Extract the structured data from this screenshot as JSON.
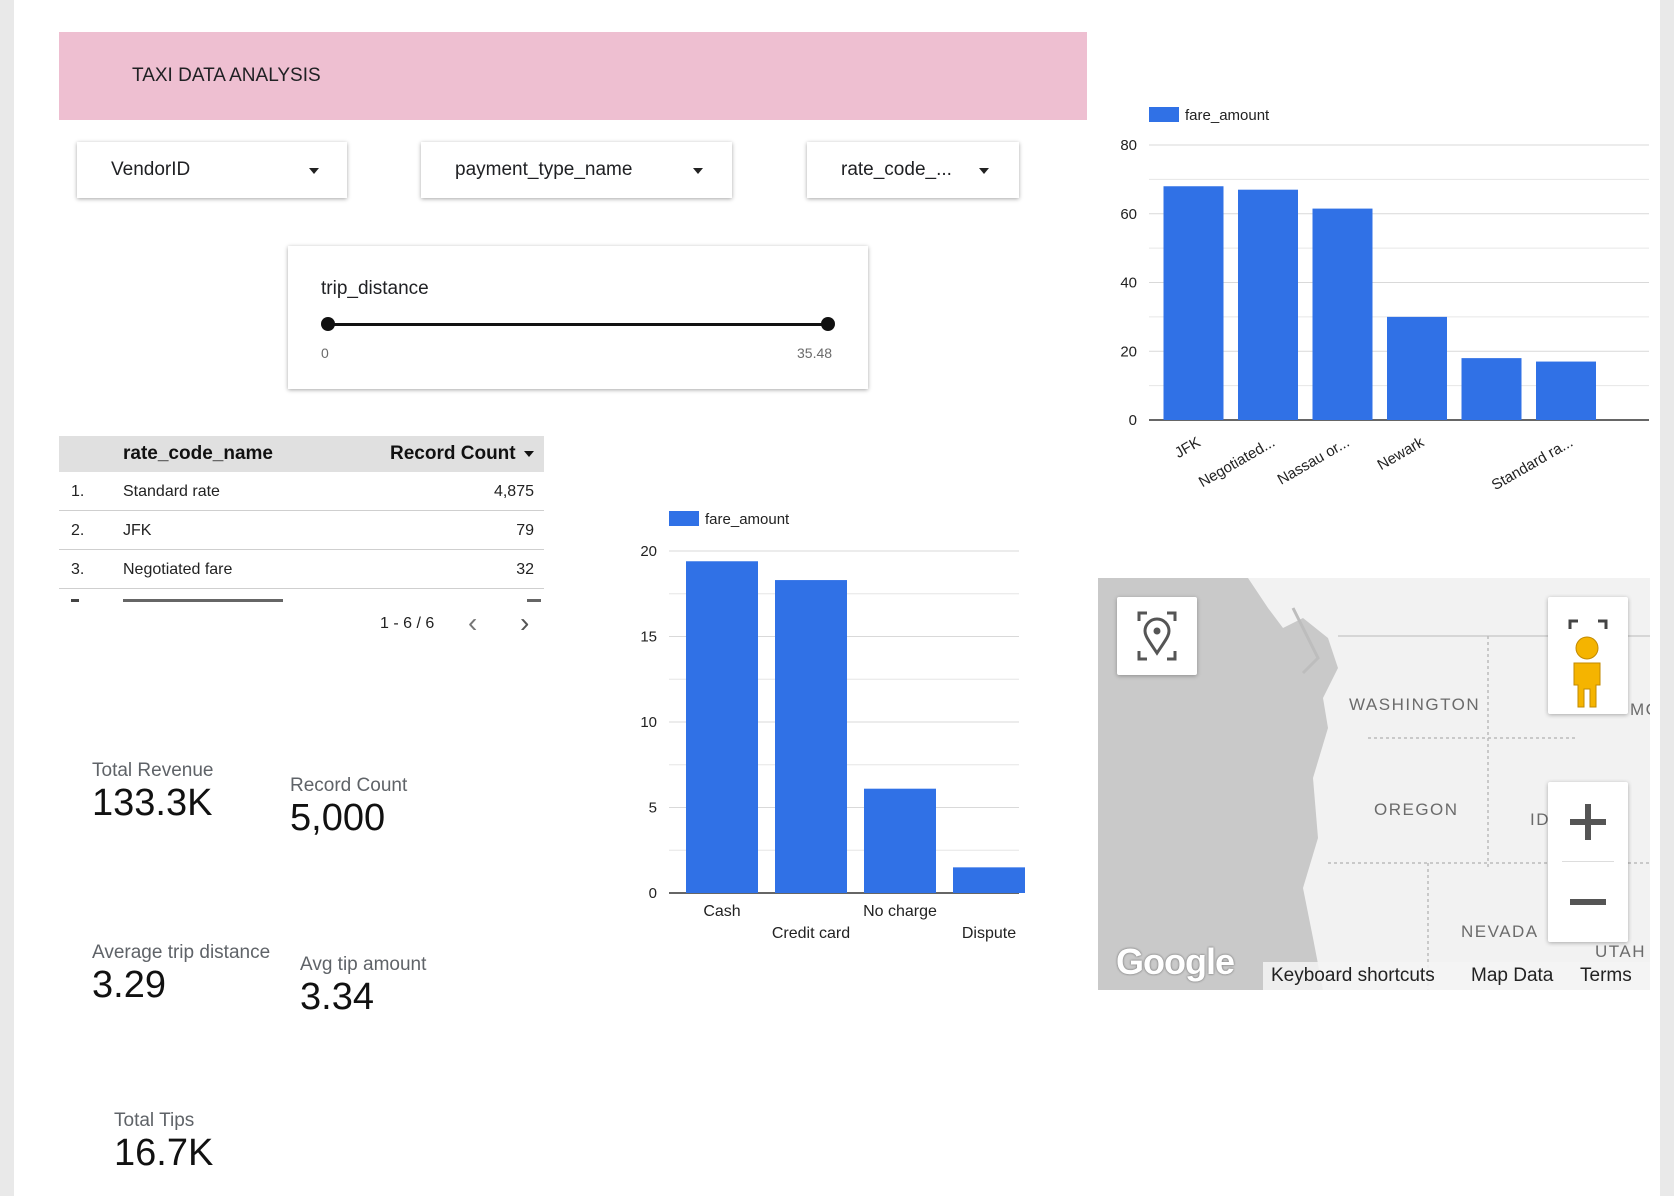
{
  "header": {
    "title": "TAXI DATA ANALYSIS"
  },
  "filters": {
    "vendor": {
      "label": "VendorID"
    },
    "payment": {
      "label": "payment_type_name"
    },
    "rate": {
      "label": "rate_code_..."
    }
  },
  "slider": {
    "label": "trip_distance",
    "min_label": "0",
    "max_label": "35.48"
  },
  "table": {
    "columns": [
      "rate_code_name",
      "Record Count"
    ],
    "rows": [
      {
        "num": "1.",
        "name": "Standard rate",
        "count": "4,875"
      },
      {
        "num": "2.",
        "name": "JFK",
        "count": "79"
      },
      {
        "num": "3.",
        "name": "Negotiated fare",
        "count": "32"
      }
    ],
    "pagination": "1 - 6 / 6"
  },
  "scorecards": {
    "total_revenue": {
      "label": "Total Revenue",
      "value": "133.3K"
    },
    "record_count": {
      "label": "Record Count",
      "value": "5,000"
    },
    "avg_trip_distance": {
      "label": "Average trip distance",
      "value": "3.29"
    },
    "avg_tip_amount": {
      "label": "Avg tip amount",
      "value": "3.34"
    },
    "total_tips": {
      "label": "Total Tips",
      "value": "16.7K"
    }
  },
  "chart_data": [
    {
      "type": "bar",
      "legend": "fare_amount",
      "categories": [
        "JFK",
        "Negotiated...",
        "Nassau or...",
        "Newark",
        "",
        "Standard ra..."
      ],
      "values": [
        68,
        67,
        61.5,
        30,
        18,
        17
      ],
      "ylim": [
        0,
        80
      ],
      "yticks": [
        0,
        20,
        40,
        60,
        80
      ],
      "color": "#3071e6"
    },
    {
      "type": "bar",
      "legend": "fare_amount",
      "categories": [
        "Cash",
        "Credit card",
        "No charge",
        "Dispute"
      ],
      "values": [
        19.4,
        18.3,
        6.1,
        1.5
      ],
      "ylim": [
        0,
        20
      ],
      "yticks": [
        0,
        5,
        10,
        15,
        20
      ],
      "color": "#3071e6"
    }
  ],
  "map": {
    "labels": [
      "WASHINGTON",
      "OREGON",
      "NEVADA",
      "ID",
      "MO",
      "UTAH"
    ],
    "logo": "Google",
    "footer": {
      "shortcuts": "Keyboard shortcuts",
      "data": "Map Data",
      "terms": "Terms"
    }
  }
}
